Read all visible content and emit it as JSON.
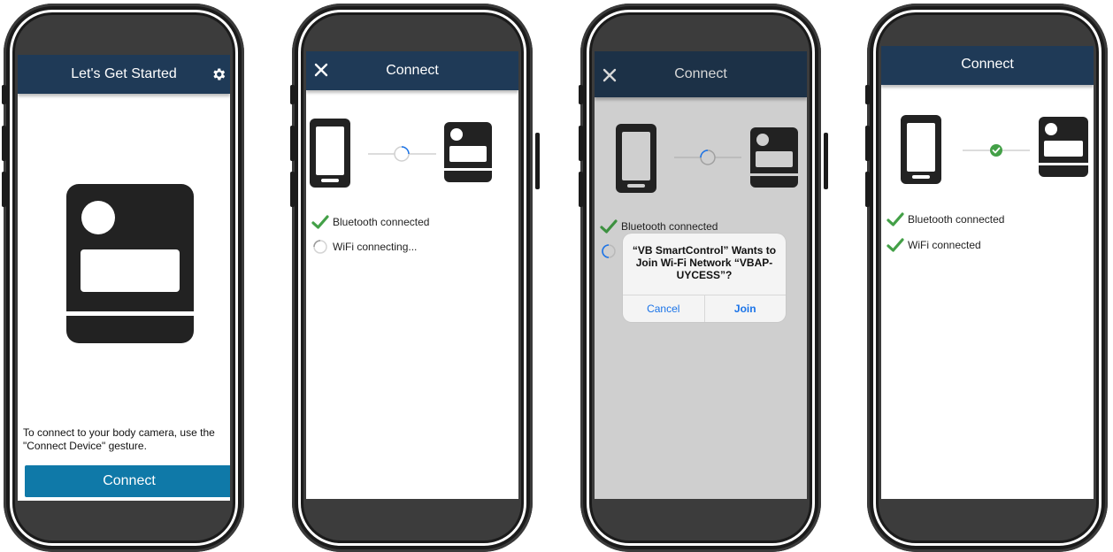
{
  "screens": [
    {
      "header_title": "Let's Get Started",
      "instruction": "To connect to your body camera, use the \"Connect Device\" gesture.",
      "connect_button": "Connect"
    },
    {
      "header_title": "Connect",
      "status": [
        {
          "label": "Bluetooth connected",
          "state": "done"
        },
        {
          "label": "WiFi connecting...",
          "state": "loading"
        }
      ]
    },
    {
      "header_title": "Connect",
      "status": [
        {
          "label": "Bluetooth connected",
          "state": "done"
        }
      ],
      "dialog": {
        "message": "“VB SmartControl” Wants to Join Wi-Fi Network “VBAP-UYCESS”?",
        "cancel": "Cancel",
        "join": "Join"
      }
    },
    {
      "header_title": "Connect",
      "status": [
        {
          "label": "Bluetooth connected",
          "state": "done"
        },
        {
          "label": "WiFi connected",
          "state": "done"
        }
      ]
    }
  ],
  "colors": {
    "header": "#1f3a57",
    "button": "#0f79a8",
    "success": "#43a047",
    "spinner": "#1a73e8",
    "dialog_button": "#1a73e8"
  }
}
